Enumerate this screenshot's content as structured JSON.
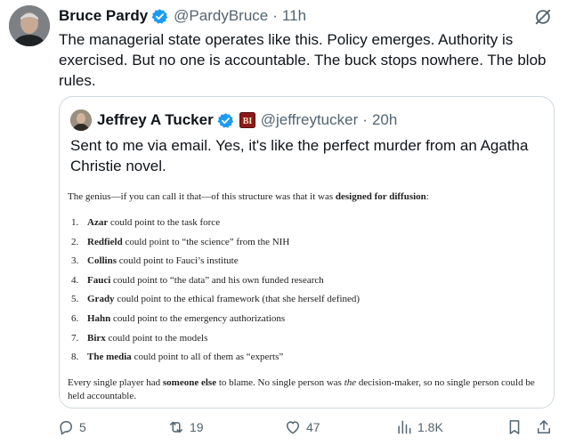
{
  "post": {
    "author_name": "Bruce Pardy",
    "handle": "@PardyBruce",
    "separator": "·",
    "time": "11h",
    "text": "The managerial state operates like this. Policy emerges. Authority is exercised. But no one is accountable. The buck stops nowhere. The blob rules."
  },
  "quote": {
    "author_name": "Jeffrey A Tucker",
    "badge_letters": "BI",
    "handle": "@jeffreytucker",
    "separator": "·",
    "time": "20h",
    "text": "Sent to me via email. Yes, it's like the perfect murder from an Agatha Christie novel.",
    "document": {
      "intro_start": "The genius—if you can call it that—of this structure was that it was ",
      "intro_bold": "designed for diffusion",
      "intro_end": ":",
      "items": [
        {
          "num": "1.",
          "bold": "Azar",
          "rest": " could point to the task force"
        },
        {
          "num": "2.",
          "bold": "Redfield",
          "rest": " could point to “the science” from the NIH"
        },
        {
          "num": "3.",
          "bold": "Collins",
          "rest": " could point to Fauci’s institute"
        },
        {
          "num": "4.",
          "bold": "Fauci",
          "rest": " could point to “the data” and his own funded research"
        },
        {
          "num": "5.",
          "bold": "Grady",
          "rest": " could point to the ethical framework (that she herself defined)"
        },
        {
          "num": "6.",
          "bold": "Hahn",
          "rest": " could point to the emergency authorizations"
        },
        {
          "num": "7.",
          "bold": "Birx",
          "rest": " could point to the models"
        },
        {
          "num": "8.",
          "bold": "The media",
          "rest": " could point to all of them as “experts”"
        }
      ],
      "outro_1": "Every single player had ",
      "outro_bold": "someone else",
      "outro_2": " to blame. No single person was ",
      "outro_italic": "the",
      "outro_3": " decision-maker, so no single person could be held accountable."
    }
  },
  "actions": {
    "replies": "5",
    "reposts": "19",
    "likes": "47",
    "views": "1.8K"
  },
  "icons": {
    "verified": "verified-badge-icon",
    "grok": "grok-icon",
    "reply": "reply-icon",
    "retweet": "retweet-icon",
    "like": "heart-icon",
    "views": "views-icon",
    "bookmark": "bookmark-icon",
    "share": "share-icon"
  },
  "colors": {
    "verified": "#1d9bf0",
    "text": "#0f1419",
    "muted": "#536471",
    "border": "#cfd9de",
    "badge_bg": "#8b1a1a"
  }
}
